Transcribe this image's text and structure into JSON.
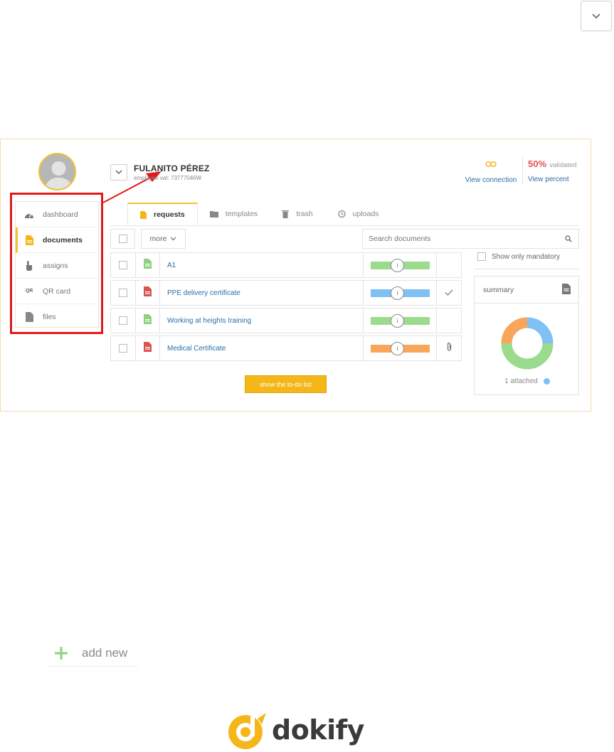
{
  "user": {
    "name": "FULANITO PÉREZ",
    "subtitle": "employee vat: 73777046W"
  },
  "connection": {
    "link_label": "View connection"
  },
  "validation": {
    "percent": "50%",
    "label": "validated",
    "link_label": "View percent"
  },
  "sidebar": {
    "items": [
      {
        "label": "dashboard",
        "icon": "dashboard-gauge-icon",
        "active": false
      },
      {
        "label": "documents",
        "icon": "document-icon",
        "active": true
      },
      {
        "label": "assigns",
        "icon": "hand-pointer-icon",
        "active": false
      },
      {
        "label": "QR card",
        "icon": "qr-icon",
        "active": false
      },
      {
        "label": "files",
        "icon": "file-icon",
        "active": false
      }
    ],
    "qr_text": "QR"
  },
  "tabs": [
    {
      "label": "requests",
      "icon": "document-icon",
      "active": true
    },
    {
      "label": "templates",
      "icon": "folder-icon",
      "active": false
    },
    {
      "label": "trash",
      "icon": "trash-icon",
      "active": false
    },
    {
      "label": "uploads",
      "icon": "history-icon",
      "active": false
    }
  ],
  "toolbar": {
    "more_label": "more",
    "search_placeholder": "Search documents"
  },
  "documents": [
    {
      "name": "A1",
      "file_color": "#8fd17e",
      "bar_color": "#9adb8e",
      "action_icon": ""
    },
    {
      "name": "PPE delivery certificate",
      "file_color": "#d9534f",
      "bar_color": "#7fc0f5",
      "action_icon": "check-icon"
    },
    {
      "name": "Working at heights training",
      "file_color": "#8fd17e",
      "bar_color": "#9adb8e",
      "action_icon": ""
    },
    {
      "name": "Medical Certificate",
      "file_color": "#d9534f",
      "bar_color": "#f9a55a",
      "action_icon": "paperclip-icon"
    }
  ],
  "info_glyph": "i",
  "todo_button_label": "show the to-do list",
  "show_only_mandatory_label": "Show only mandatory",
  "summary": {
    "title": "summary",
    "attached_label": "1 attached",
    "donut": [
      {
        "name": "blue",
        "color": "#7fc0f5",
        "value": 25
      },
      {
        "name": "green",
        "color": "#9adb8e",
        "value": 50
      },
      {
        "name": "orange",
        "color": "#f9a55a",
        "value": 25
      }
    ]
  },
  "add_new_label": "add new",
  "brand": {
    "name": "dokify",
    "accent": "#f5c033"
  }
}
